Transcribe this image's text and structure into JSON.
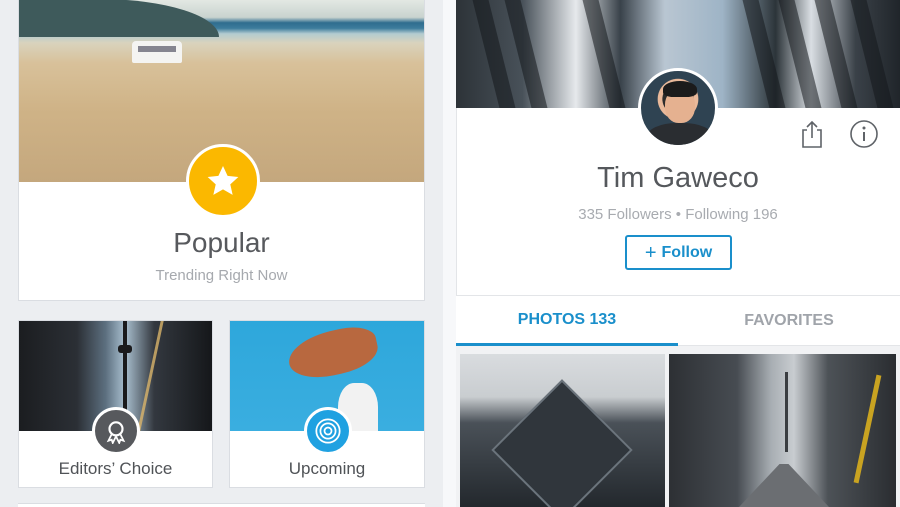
{
  "left": {
    "popular": {
      "title": "Popular",
      "subtitle": "Trending Right Now"
    },
    "editors": {
      "label": "Editors’ Choice"
    },
    "upcoming": {
      "label": "Upcoming"
    }
  },
  "profile": {
    "name": "Tim Gaweco",
    "stats": "335 Followers • Following 196",
    "follow_label": "Follow"
  },
  "tabs": [
    {
      "label": "PHOTOS 133",
      "active": true
    },
    {
      "label": "FAVORITES",
      "active": false
    }
  ],
  "icons": {
    "popular_badge": "star-icon",
    "editors_badge": "award-ribbon-icon",
    "upcoming_badge": "concentric-circles-icon",
    "share": "share-icon",
    "info": "info-icon",
    "follow": "plus-icon"
  },
  "colors": {
    "accent": "#1a8fcb",
    "popular_badge": "#fbb800",
    "editors_badge": "#57595d",
    "upcoming_badge": "#1fa1e1"
  }
}
